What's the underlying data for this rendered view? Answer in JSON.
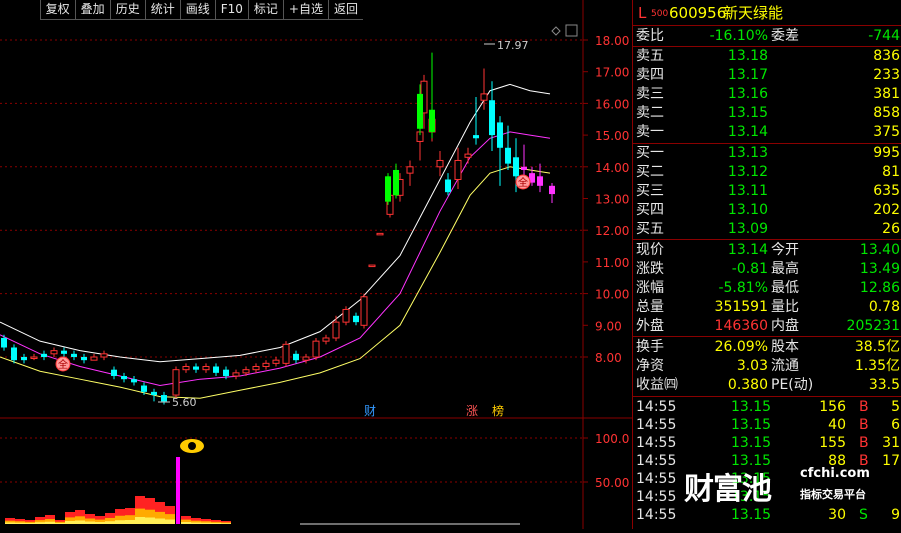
{
  "toolbar": {
    "buttons": [
      "复权",
      "叠加",
      "历史",
      "统计",
      "画线",
      "F10",
      "标记",
      "+自选",
      "返回"
    ]
  },
  "chart": {
    "price_ticks": [
      "18.00",
      "17.00",
      "16.00",
      "15.00",
      "14.00",
      "13.00",
      "12.00",
      "11.00",
      "10.00",
      "9.00",
      "8.00"
    ],
    "volume_ticks": [
      "100.0",
      "50.00"
    ],
    "high_label": "17.97",
    "low_label": "5.60",
    "markers": [
      "财",
      "涨",
      "榜"
    ],
    "quan_marker": "全",
    "colors": {
      "up": "#ff3333",
      "down": "#00ffff",
      "ma_white": "#ffffff",
      "ma_magenta": "#ff33ff",
      "ma_yellow": "#ffff66",
      "grid": "#8a0000"
    }
  },
  "header": {
    "logo_l": "L",
    "badge": "500",
    "code": "600956",
    "name": "新天绿能"
  },
  "weibi": {
    "label1": "委比",
    "value1": "-16.10%",
    "label2": "委差",
    "value2": "-744"
  },
  "asks": [
    {
      "label": "卖五",
      "price": "13.18",
      "vol": "836"
    },
    {
      "label": "卖四",
      "price": "13.17",
      "vol": "233"
    },
    {
      "label": "卖三",
      "price": "13.16",
      "vol": "381"
    },
    {
      "label": "卖二",
      "price": "13.15",
      "vol": "858"
    },
    {
      "label": "卖一",
      "price": "13.14",
      "vol": "375"
    }
  ],
  "bids": [
    {
      "label": "买一",
      "price": "13.13",
      "vol": "995"
    },
    {
      "label": "买二",
      "price": "13.12",
      "vol": "81"
    },
    {
      "label": "买三",
      "price": "13.11",
      "vol": "635"
    },
    {
      "label": "买四",
      "price": "13.10",
      "vol": "202"
    },
    {
      "label": "买五",
      "price": "13.09",
      "vol": "26"
    }
  ],
  "stats1": [
    {
      "l1": "现价",
      "v1": "13.14",
      "l2": "今开",
      "v2": "13.40"
    },
    {
      "l1": "涨跌",
      "v1": "-0.81",
      "l2": "最高",
      "v2": "13.49"
    },
    {
      "l1": "涨幅",
      "v1": "-5.81%",
      "l2": "最低",
      "v2": "12.86"
    },
    {
      "l1": "总量",
      "v1": "351591",
      "l2": "量比",
      "v2": "0.78"
    },
    {
      "l1": "外盘",
      "v1": "146360",
      "l2": "内盘",
      "v2": "205231"
    }
  ],
  "stats2": [
    {
      "l1": "换手",
      "v1": "26.09%",
      "l2": "股本",
      "v2": "38.5亿"
    },
    {
      "l1": "净资",
      "v1": "3.03",
      "l2": "流通",
      "v2": "1.35亿"
    },
    {
      "l1": "收益㈣",
      "v1": "0.380",
      "l2": "PE(动)",
      "v2": "33.5"
    }
  ],
  "trades": [
    {
      "time": "14:55",
      "price": "13.15",
      "vol": "156",
      "side": "B",
      "num": "5"
    },
    {
      "time": "14:55",
      "price": "13.15",
      "vol": "40",
      "side": "B",
      "num": "6"
    },
    {
      "time": "14:55",
      "price": "13.15",
      "vol": "155",
      "side": "B",
      "num": "31"
    },
    {
      "time": "14:55",
      "price": "13.15",
      "vol": "88",
      "side": "B",
      "num": "17"
    },
    {
      "time": "14:55",
      "price": "13.15",
      "vol": "",
      "side": "",
      "num": ""
    },
    {
      "time": "14:55",
      "price": "13.15",
      "vol": "",
      "side": "",
      "num": ""
    },
    {
      "time": "14:55",
      "price": "13.15",
      "vol": "30",
      "side": "S",
      "num": "9"
    }
  ],
  "watermark": {
    "brand": "财富池",
    "domain": "cfchi.com",
    "slogan": "指标交易平台"
  }
}
